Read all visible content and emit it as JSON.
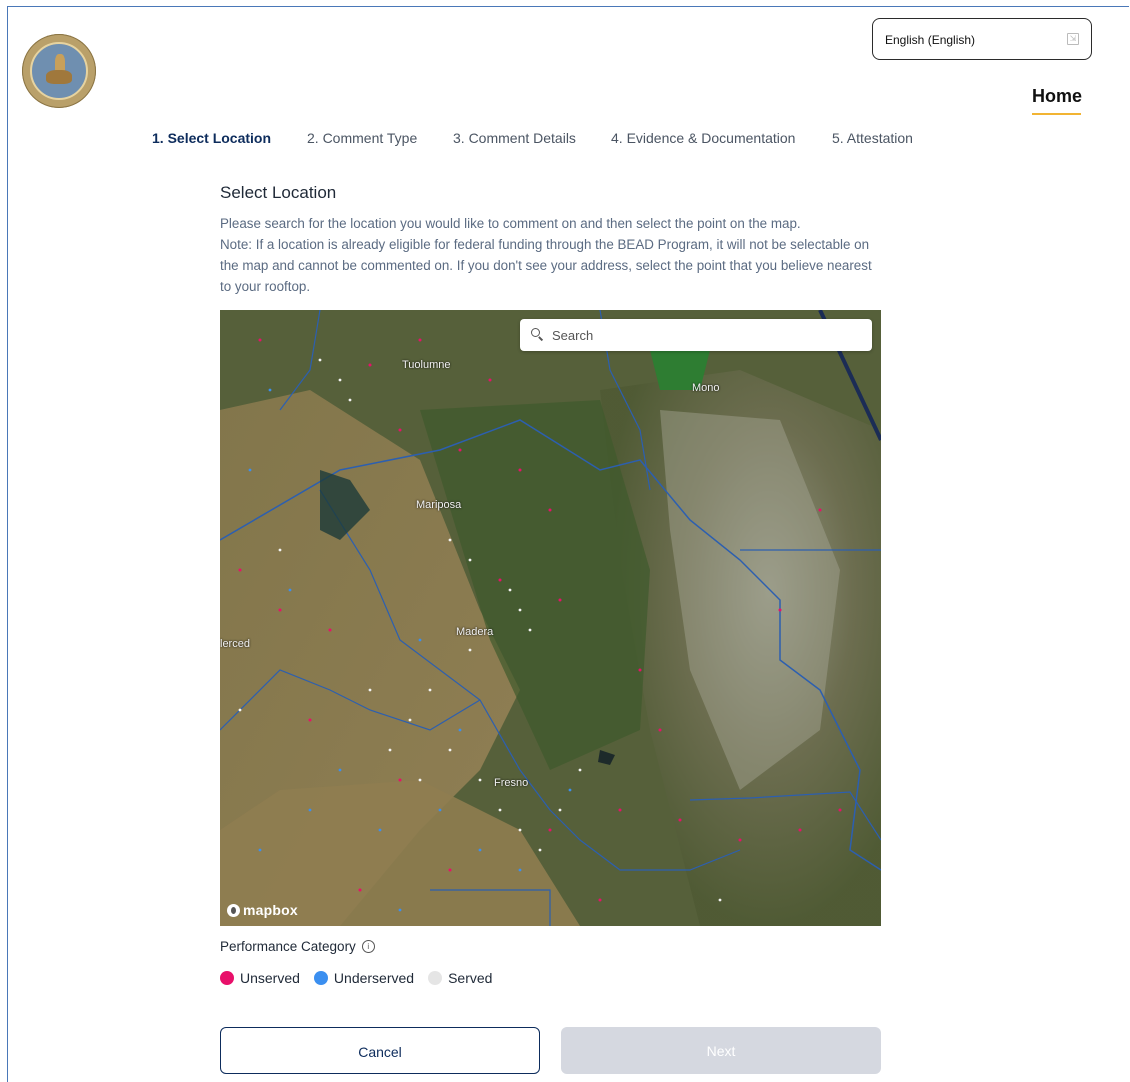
{
  "header": {
    "seal_text": "PUBLIC UTILITIES COMMISSION · STATE OF CALIFORNIA",
    "language_selector": "English (English)",
    "home_label": "Home",
    "home_underline_color": "#f2b433"
  },
  "steps": [
    {
      "label": "1. Select Location",
      "active": true
    },
    {
      "label": "2. Comment Type",
      "active": false
    },
    {
      "label": "3. Comment Details",
      "active": false
    },
    {
      "label": "4. Evidence & Documentation",
      "active": false
    },
    {
      "label": "5. Attestation",
      "active": false
    }
  ],
  "section": {
    "title": "Select Location",
    "description_line1": "Please search for the location you would like to comment on and then select the point on the map.",
    "description_line2": "Note: If a location is already eligible for federal funding through the BEAD Program, it will not be selectable on the map and cannot be commented on. If you don't see your address, select the point that you believe nearest to your rooftop."
  },
  "map": {
    "search_placeholder": "Search",
    "labels": {
      "tuolumne": "Tuolumne",
      "mono": "Mono",
      "mariposa": "Mariposa",
      "madera": "Madera",
      "merced": "lerced",
      "fresno": "Fresno"
    },
    "attribution": "mapbox"
  },
  "performance": {
    "title": "Performance Category",
    "legend": [
      {
        "label": "Unserved",
        "color": "#e8106a"
      },
      {
        "label": "Underserved",
        "color": "#3b8ff0"
      },
      {
        "label": "Served",
        "color": "#e5e5e5"
      }
    ]
  },
  "buttons": {
    "cancel": "Cancel",
    "next": "Next"
  },
  "colors": {
    "primary": "#0d2c5c",
    "disabled": "#d5d8e0"
  }
}
